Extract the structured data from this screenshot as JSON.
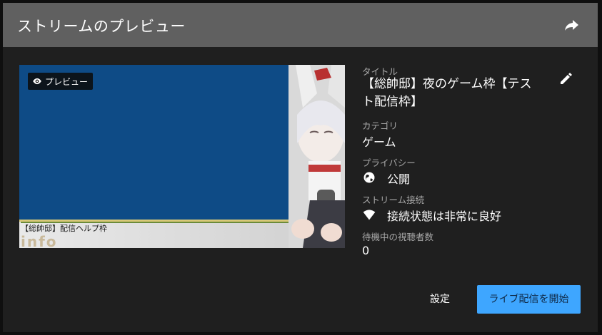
{
  "header": {
    "title": "ストリームのプレビュー",
    "share_icon": "share-icon"
  },
  "preview": {
    "badge_label": "プレビュー",
    "overlay_caption": "【総帥邸】配信ヘルプ枠",
    "overlay_logo": "info"
  },
  "info": {
    "title_label": "タイトル",
    "title_value": "【総帥邸】夜のゲーム枠【テスト配信枠】",
    "category_label": "カテゴリ",
    "category_value": "ゲーム",
    "privacy_label": "プライバシー",
    "privacy_value": "公開",
    "connection_label": "ストリーム接続",
    "connection_value": "接続状態は非常に良好",
    "viewers_label": "待機中の視聴者数",
    "viewers_value": "0"
  },
  "footer": {
    "settings_label": "設定",
    "start_label": "ライブ配信を開始"
  },
  "colors": {
    "header_bg": "#606060",
    "dialog_bg": "#1f1f1f",
    "accent": "#3ea6ff",
    "preview_blue": "#0e4b86"
  }
}
